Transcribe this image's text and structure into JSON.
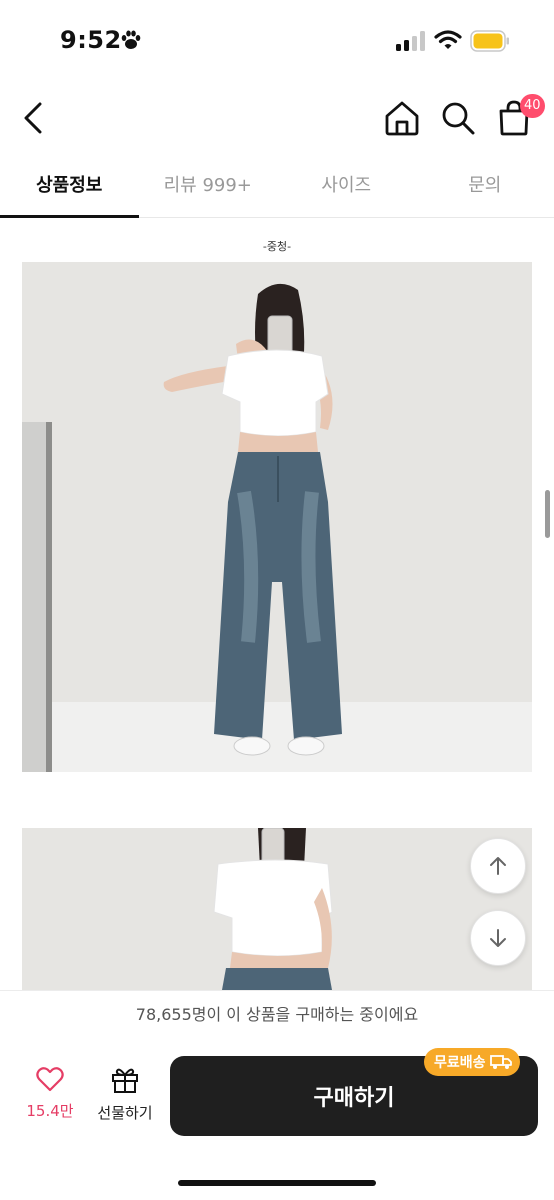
{
  "status_bar": {
    "time": "9:52",
    "battery_color": "#f7c31a"
  },
  "header": {
    "cart_count": "40"
  },
  "tabs": [
    {
      "label": "상품정보",
      "active": true
    },
    {
      "label": "리뷰 999+",
      "active": false
    },
    {
      "label": "사이즈",
      "active": false
    },
    {
      "label": "문의",
      "active": false
    }
  ],
  "content": {
    "caption": "-중청-"
  },
  "notice": {
    "text": "78,655명이 이 상품을 구매하는 중이에요"
  },
  "bottom_bar": {
    "like_count": "15.4만",
    "gift_label": "선물하기",
    "buy_label": "구매하기",
    "free_shipping": "무료배송"
  },
  "colors": {
    "accent_pink": "#e53d65",
    "badge_orange": "#f7a928",
    "buy_button": "#1f1f1f"
  }
}
